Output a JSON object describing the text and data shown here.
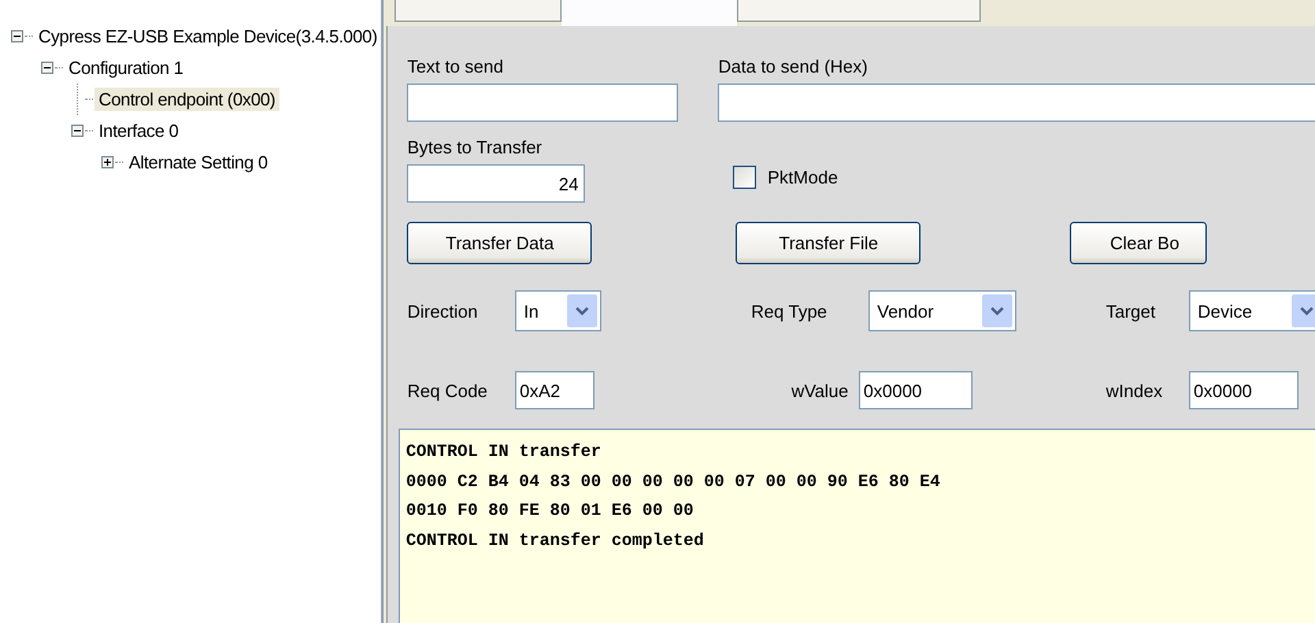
{
  "tree": [
    {
      "label": "Cypress EZ-USB Example Device(3.4.5.000)",
      "expanded": true,
      "selected": false,
      "children": [
        {
          "label": "Configuration 1",
          "expanded": true,
          "selected": false,
          "children": [
            {
              "label": "Control endpoint (0x00)",
              "selected": true
            },
            {
              "label": "Interface 0",
              "expanded": true,
              "selected": false,
              "children": [
                {
                  "label": "Alternate Setting 0",
                  "expanded": false,
                  "selected": false
                }
              ]
            }
          ]
        }
      ]
    }
  ],
  "tabs": [
    {
      "selected": false
    },
    {
      "selected": true
    },
    {
      "selected": false
    }
  ],
  "text_to_send": {
    "label": "Text to send"
  },
  "data_to_send": {
    "label": "Data to send (Hex)"
  },
  "bytes_to_transfer": {
    "label": "Bytes to Transfer",
    "value": "24"
  },
  "pkt_mode": {
    "label": "PktMode",
    "checked": false
  },
  "buttons": [
    "Transfer Data",
    "Transfer File",
    "Clear Bo"
  ],
  "selects": [
    {
      "label": "Direction",
      "value": "In"
    },
    {
      "label": "Req Type",
      "value": "Vendor"
    },
    {
      "label": "Target",
      "value": "Device"
    }
  ],
  "params": [
    {
      "label": "Req Code",
      "value": "0xA2"
    },
    {
      "label": "wValue",
      "value": "0x0000"
    },
    {
      "label": "wIndex",
      "value": "0x0000"
    }
  ],
  "output": [
    "CONTROL IN transfer",
    "0000 C2 B4 04 83 00 00 00 00 00 07 00 00 90 E6 80 E4",
    "0010 F0 80 FE 80 01 E6 00 00",
    "CONTROL IN transfer completed"
  ]
}
